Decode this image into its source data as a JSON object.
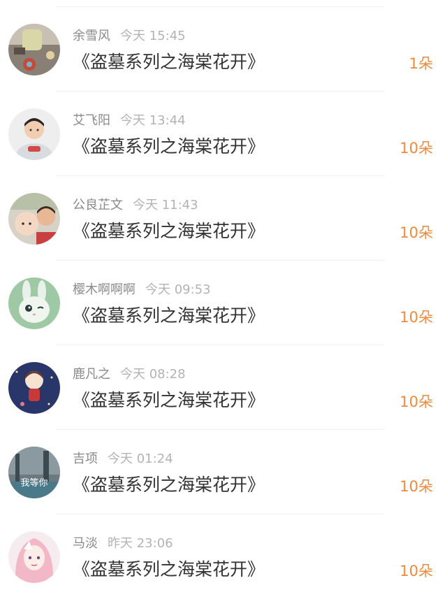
{
  "colors": {
    "amount": "#f08a3a",
    "name": "#8a8a8a",
    "time": "#b3b3b3",
    "title": "#333333"
  },
  "items": [
    {
      "user": "余雪风",
      "time": "今天 15:45",
      "title": "《盗墓系列之海棠花开》",
      "amount": "1朵",
      "avatar": "lantern-avatar"
    },
    {
      "user": "艾飞阳",
      "time": "今天 13:44",
      "title": "《盗墓系列之海棠花开》",
      "amount": "10朵",
      "avatar": "boy-avatar"
    },
    {
      "user": "公良芷文",
      "time": "今天 11:43",
      "title": "《盗墓系列之海棠花开》",
      "amount": "10朵",
      "avatar": "family-avatar"
    },
    {
      "user": "樱木啊啊啊",
      "time": "今天 09:53",
      "title": "《盗墓系列之海棠花开》",
      "amount": "10朵",
      "avatar": "bunny-avatar"
    },
    {
      "user": "鹿凡之",
      "time": "今天 08:28",
      "title": "《盗墓系列之海棠花开》",
      "amount": "10朵",
      "avatar": "cartoon-girl-avatar"
    },
    {
      "user": "吉项",
      "time": "今天 01:24",
      "title": "《盗墓系列之海棠花开》",
      "amount": "10朵",
      "avatar": "scenery-avatar",
      "avatar_text": "我等你"
    },
    {
      "user": "马淡",
      "time": "昨天 23:06",
      "title": "《盗墓系列之海棠花开》",
      "amount": "10朵",
      "avatar": "anime-avatar"
    }
  ]
}
